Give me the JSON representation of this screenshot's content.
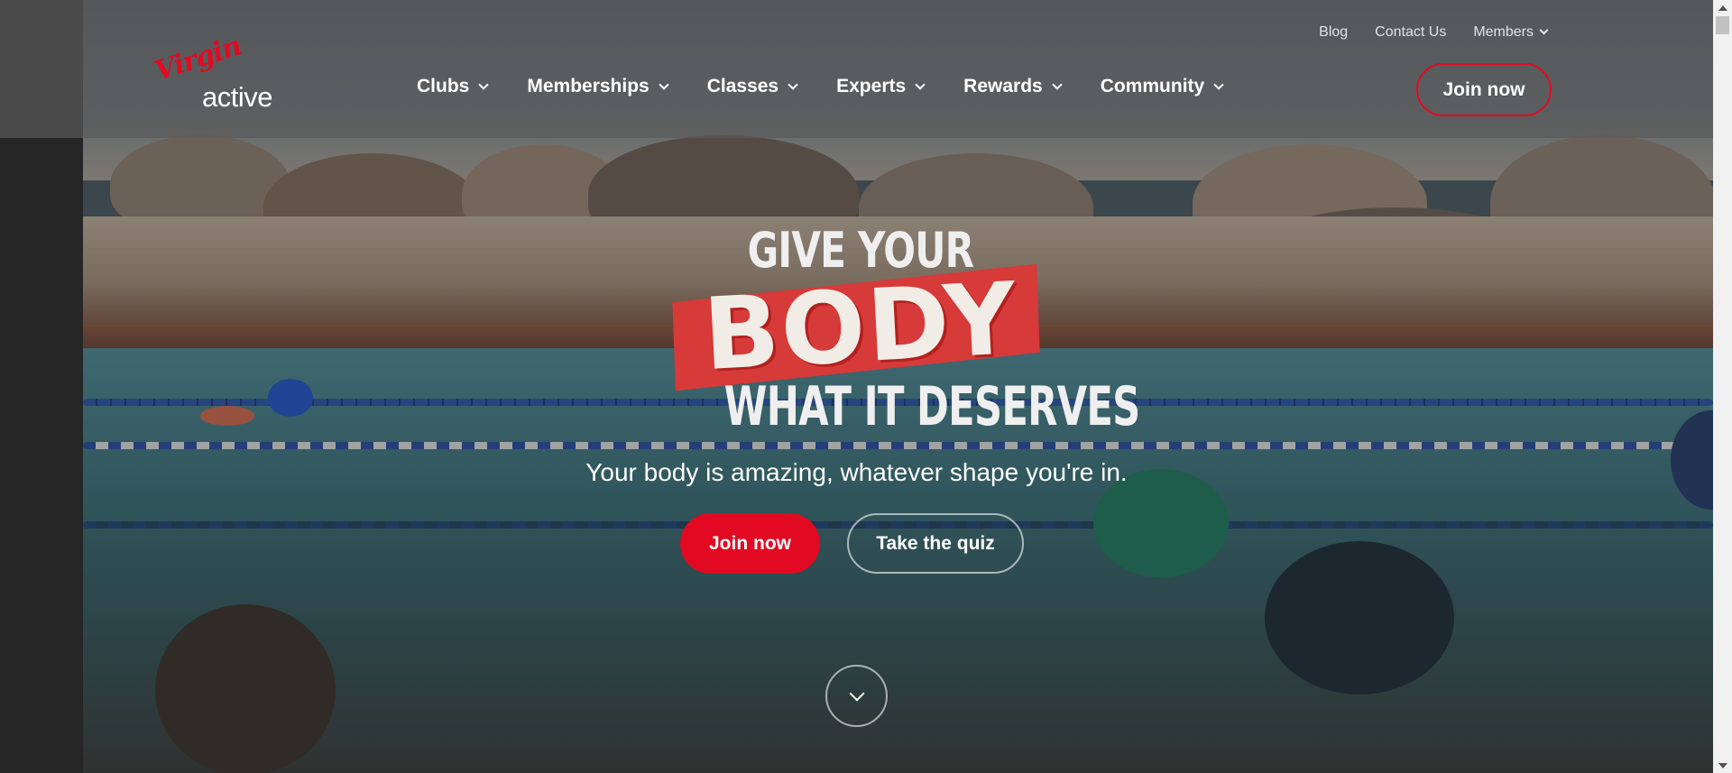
{
  "brand": {
    "logo_script": "Virgin",
    "logo_word": "active",
    "accent_color": "#e10a22"
  },
  "utility_nav": {
    "blog": "Blog",
    "contact": "Contact Us",
    "members": "Members"
  },
  "main_nav": {
    "items": [
      {
        "label": "Clubs"
      },
      {
        "label": "Memberships"
      },
      {
        "label": "Classes"
      },
      {
        "label": "Experts"
      },
      {
        "label": "Rewards"
      },
      {
        "label": "Community"
      }
    ],
    "join_label": "Join now"
  },
  "hero": {
    "headline_top": "GIVE YOUR",
    "headline_body": "BODY",
    "headline_bottom": "WHAT IT DESERVES",
    "subtitle": "Your body is amazing, whatever shape you're in.",
    "primary_cta": "Join now",
    "secondary_cta": "Take the quiz",
    "scroll_icon": "chevron-down-icon"
  }
}
